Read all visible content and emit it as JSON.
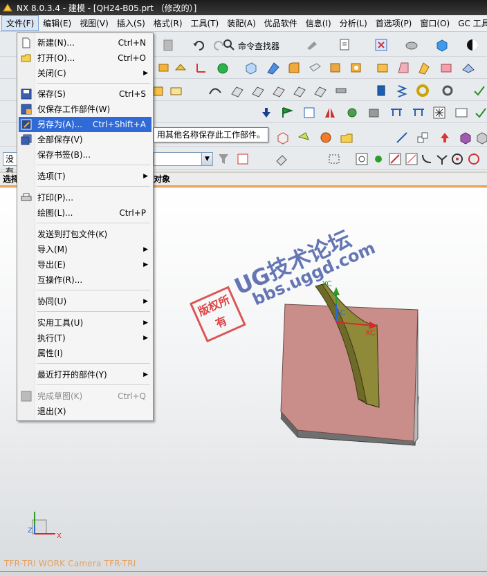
{
  "window": {
    "title": "NX 8.0.3.4 - 建模 - [QH24-B05.prt （修改的）]"
  },
  "menubar": [
    {
      "label": "文件(F)",
      "active": true
    },
    {
      "label": "编辑(E)"
    },
    {
      "label": "视图(V)"
    },
    {
      "label": "插入(S)"
    },
    {
      "label": "格式(R)"
    },
    {
      "label": "工具(T)"
    },
    {
      "label": "装配(A)"
    },
    {
      "label": "优品软件"
    },
    {
      "label": "信息(I)"
    },
    {
      "label": "分析(L)"
    },
    {
      "label": "首选项(P)"
    },
    {
      "label": "窗口(O)"
    },
    {
      "label": "GC 工具箱"
    }
  ],
  "toolbar": {
    "command_finder": "命令查找器",
    "filter_combo": "没有"
  },
  "selection_bar": {
    "left": "选择",
    "right": "对象"
  },
  "file_menu": {
    "items": [
      {
        "label": "新建(N)...",
        "shortcut": "Ctrl+N",
        "icon": "new-file-icon"
      },
      {
        "label": "打开(O)...",
        "shortcut": "Ctrl+O",
        "icon": "open-folder-icon"
      },
      {
        "label": "关闭(C)",
        "submenu": true
      },
      {
        "label": "保存(S)",
        "shortcut": "Ctrl+S",
        "icon": "save-icon"
      },
      {
        "label": "仅保存工作部件(W)",
        "icon": "save-work-part-icon"
      },
      {
        "label": "另存为(A)...",
        "shortcut": "Ctrl+Shift+A",
        "icon": "save-as-icon",
        "highlighted": true
      },
      {
        "label": "全部保存(V)",
        "icon": "save-all-icon"
      },
      {
        "label": "保存书签(B)..."
      },
      {
        "label": "选项(T)",
        "submenu": true
      },
      {
        "label": "打印(P)...",
        "icon": "printer-icon"
      },
      {
        "label": "绘图(L)...",
        "shortcut": "Ctrl+P"
      },
      {
        "label": "发送到打包文件(K)"
      },
      {
        "label": "导入(M)",
        "submenu": true
      },
      {
        "label": "导出(E)",
        "submenu": true
      },
      {
        "label": "互操作(R)..."
      },
      {
        "label": "协同(U)",
        "submenu": true
      },
      {
        "label": "实用工具(U)",
        "submenu": true
      },
      {
        "label": "执行(T)",
        "submenu": true
      },
      {
        "label": "属性(I)"
      },
      {
        "label": "最近打开的部件(Y)",
        "submenu": true
      },
      {
        "label": "完成草图(K)",
        "shortcut": "Ctrl+Q",
        "icon": "finish-sketch-icon",
        "disabled": true
      },
      {
        "label": "退出(X)"
      }
    ]
  },
  "tooltip": "用其他名称保存此工作部件。",
  "viewport": {
    "camera_label": "TFR-TRI WORK Camera TFR-TRI",
    "axes": {
      "yc": "YC",
      "zc": "ZC",
      "xc": "XC",
      "x": "X",
      "z": "Z"
    }
  },
  "watermark": {
    "stamp": "版权所有",
    "brand": "UG技术论坛",
    "url": "bbs.uggd.com"
  },
  "colors": {
    "highlight": "#2f6ad6",
    "part_face": "#c98d8a",
    "part_wall": "#6e6a2a",
    "selection_accent": "#f29a3e"
  }
}
